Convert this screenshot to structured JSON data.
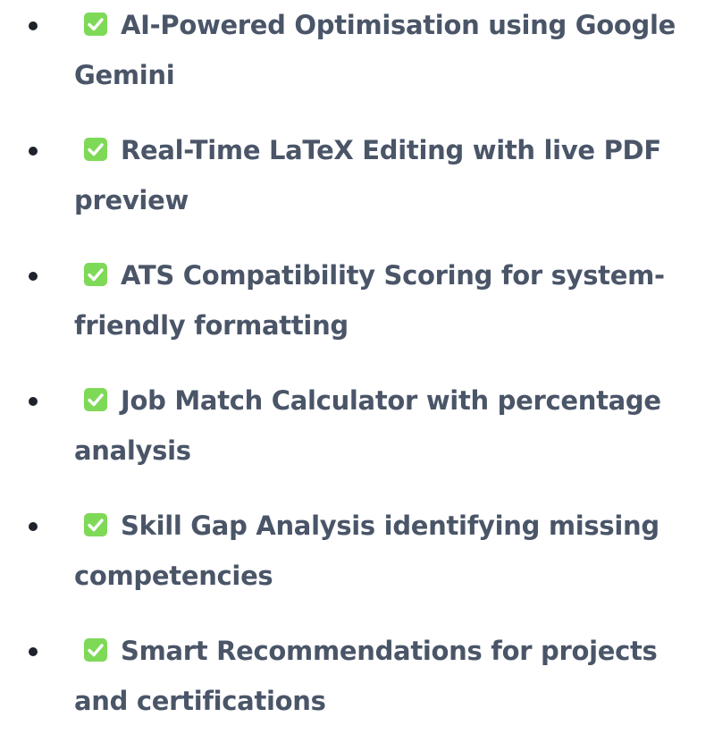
{
  "features": [
    {
      "text": "AI-Powered Optimisation using Google Gemini",
      "icon": "check-box-icon"
    },
    {
      "text": "Real-Time LaTeX Editing with live PDF preview",
      "icon": "check-box-icon"
    },
    {
      "text": "ATS Compatibility Scoring for system-friendly formatting",
      "icon": "check-box-icon"
    },
    {
      "text": "Job Match Calculator with percentage analysis",
      "icon": "check-box-icon"
    },
    {
      "text": "Skill Gap Analysis identifying missing competencies",
      "icon": "check-box-icon"
    },
    {
      "text": "Smart Recommendations for projects and certifications",
      "icon": "check-box-icon"
    }
  ],
  "colors": {
    "text": "#4a5568",
    "bullet": "#1e232b",
    "check_bg": "#7ed957",
    "check_mark": "#ffffff"
  }
}
